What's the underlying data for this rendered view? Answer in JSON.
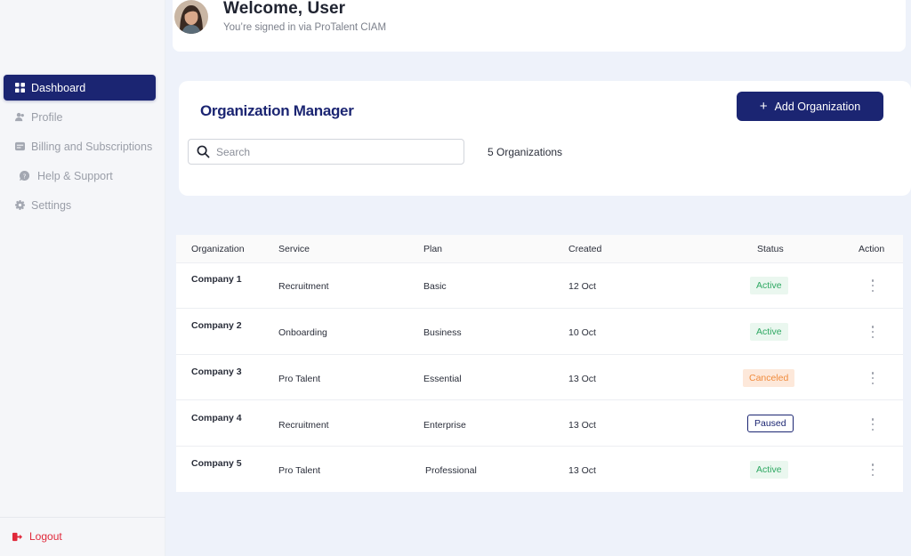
{
  "sidebar": {
    "items": [
      {
        "label": "Dashboard",
        "icon": "dashboard-icon",
        "active": true
      },
      {
        "label": "Profile",
        "icon": "profile-icon",
        "active": false
      },
      {
        "label": "Billing and Subscriptions",
        "icon": "billing-icon",
        "active": false
      },
      {
        "label": "Help & Support",
        "icon": "help-icon",
        "active": false
      },
      {
        "label": "Settings",
        "icon": "gear-icon",
        "active": false
      }
    ],
    "logout_label": "Logout"
  },
  "header": {
    "title": "Welcome, User",
    "subtitle": "You’re signed in via ProTalent CIAM"
  },
  "org_manager": {
    "title": "Organization Manager",
    "add_button_label": "Add Organization",
    "search_placeholder": "Search",
    "count_text": "5 Organizations"
  },
  "table": {
    "headers": [
      "Organization",
      "Service",
      "Plan",
      "Created",
      "Status",
      "Action"
    ],
    "rows": [
      {
        "organization": "Company 1",
        "service": "Recruitment",
        "plan": "Basic",
        "created": "12 Oct",
        "status": "Active"
      },
      {
        "organization": "Company 2",
        "service": "Onboarding",
        "plan": "Business",
        "created": "10 Oct",
        "status": "Active"
      },
      {
        "organization": "Company 3",
        "service": "Pro Talent",
        "plan": "Essential",
        "created": "13 Oct",
        "status": "Canceled"
      },
      {
        "organization": "Company 4",
        "service": "Recruitment",
        "plan": "Enterprise",
        "created": "13 Oct",
        "status": "Paused"
      },
      {
        "organization": "Company 5",
        "service": "Pro Talent",
        "plan": "Professional",
        "created": "13 Oct",
        "status": "Active"
      }
    ]
  },
  "colors": {
    "primary": "#1b2572",
    "active_badge": "#2ea862",
    "canceled_badge": "#f08b3c",
    "logout": "#e0283a"
  }
}
